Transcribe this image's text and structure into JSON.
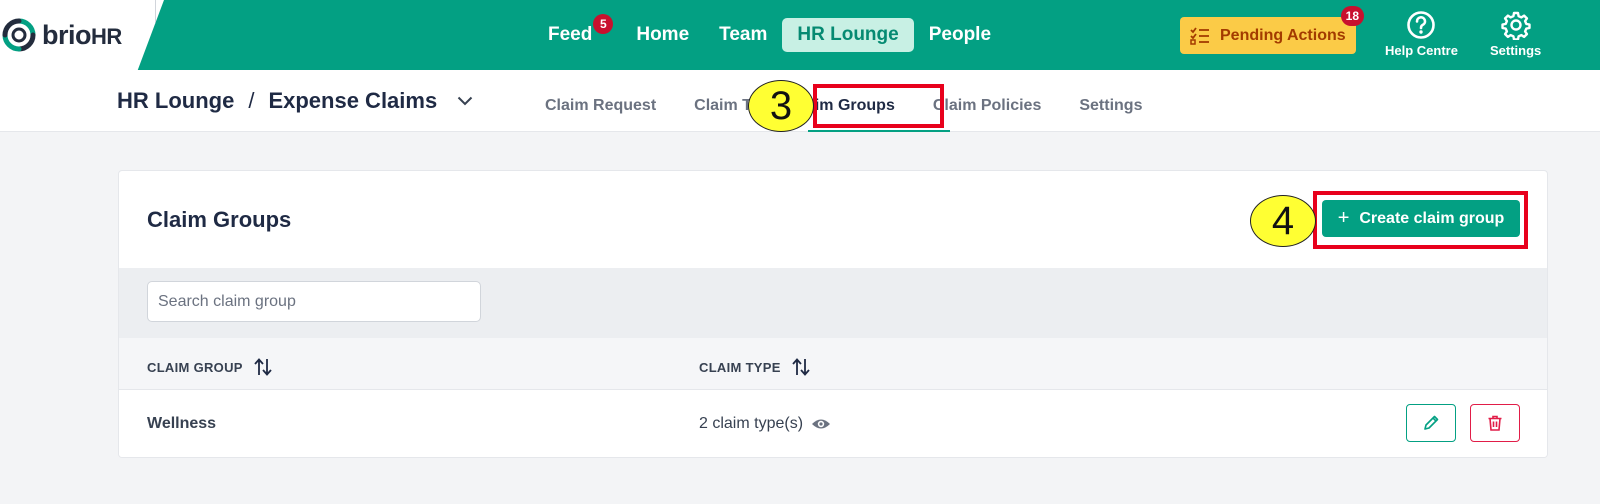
{
  "brand": {
    "name_main": "brio",
    "name_suffix": "HR"
  },
  "nav": {
    "items": [
      {
        "label": "Feed",
        "badge": "5"
      },
      {
        "label": "Home"
      },
      {
        "label": "Team"
      },
      {
        "label": "HR Lounge",
        "active": true
      },
      {
        "label": "People"
      }
    ]
  },
  "pending_actions": {
    "label": "Pending Actions",
    "badge": "18"
  },
  "utilities": {
    "help": {
      "label": "Help Centre",
      "icon": "question-circle-icon"
    },
    "settings": {
      "label": "Settings",
      "icon": "gear-icon"
    }
  },
  "breadcrumb": {
    "parent": "HR Lounge",
    "separator": "/",
    "current": "Expense Claims"
  },
  "tabs": [
    {
      "label": "Claim Request"
    },
    {
      "label": "Claim T"
    },
    {
      "label": "Claim Groups",
      "active": true
    },
    {
      "label": "Claim Policies"
    },
    {
      "label": "Settings"
    }
  ],
  "card": {
    "title": "Claim Groups",
    "create_button": {
      "label": "Create claim group",
      "icon": "plus-icon"
    },
    "search": {
      "placeholder": "Search claim group",
      "value": ""
    },
    "table": {
      "columns": [
        "CLAIM GROUP",
        "CLAIM TYPE"
      ],
      "rows": [
        {
          "claim_group": "Wellness",
          "claim_type": "2 claim type(s)"
        }
      ]
    }
  },
  "annotations": {
    "step3": "3",
    "step4": "4"
  },
  "colors": {
    "brand_green": "#03a083",
    "active_nav_bg": "#c8f0e4",
    "pending_bg": "#fbcb47",
    "badge_red": "#c8102e",
    "annotation_yellow": "#ffff33",
    "annotation_red": "#e8001c"
  }
}
